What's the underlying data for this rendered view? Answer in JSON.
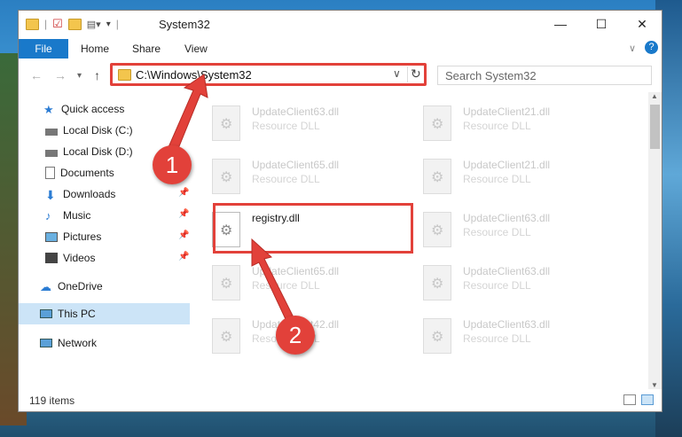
{
  "window": {
    "title": "System32"
  },
  "ribbon": {
    "tabs": [
      "File",
      "Home",
      "Share",
      "View"
    ]
  },
  "nav": {
    "address": "C:\\Windows\\System32",
    "search_placeholder": "Search System32"
  },
  "sidebar": {
    "items": [
      {
        "label": "Quick access"
      },
      {
        "label": "Local Disk (C:)"
      },
      {
        "label": "Local Disk (D:)"
      },
      {
        "label": "Documents"
      },
      {
        "label": "Downloads"
      },
      {
        "label": "Music"
      },
      {
        "label": "Pictures"
      },
      {
        "label": "Videos"
      },
      {
        "label": "OneDrive"
      },
      {
        "label": "This PC"
      },
      {
        "label": "Network"
      }
    ]
  },
  "files": {
    "left": [
      {
        "name": "UpdateClient63.dll",
        "type": "Resource DLL"
      },
      {
        "name": "UpdateClient65.dll",
        "type": "Resource DLL"
      },
      {
        "name": "registry.dll",
        "type": ""
      },
      {
        "name": "UpdateClient65.dll",
        "type": "Resource DLL"
      },
      {
        "name": "UpdateClient42.dll",
        "type": "Resource DLL"
      }
    ],
    "right": [
      {
        "name": "UpdateClient21.dll",
        "type": "Resource DLL"
      },
      {
        "name": "UpdateClient21.dll",
        "type": "Resource DLL"
      },
      {
        "name": "UpdateClient63.dll",
        "type": "Resource DLL"
      },
      {
        "name": "UpdateClient63.dll",
        "type": "Resource DLL"
      },
      {
        "name": "UpdateClient63.dll",
        "type": "Resource DLL"
      }
    ]
  },
  "status": {
    "count": "119 items"
  },
  "callouts": [
    "1",
    "2"
  ],
  "colors": {
    "accent": "#1979ca",
    "highlight": "#e2413a",
    "selection": "#cce4f7"
  }
}
